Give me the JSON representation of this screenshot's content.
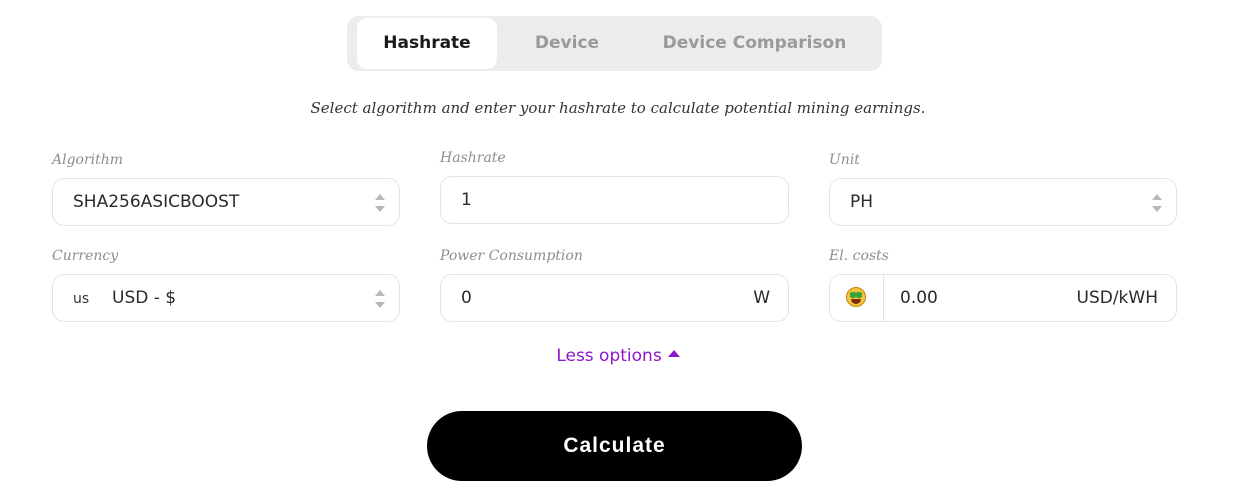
{
  "tabs": {
    "hashrate": "Hashrate",
    "device": "Device",
    "comparison": "Device Comparison",
    "active": "Hashrate"
  },
  "subtitle": "Select algorithm and enter your hashrate to calculate potential mining earnings.",
  "form": {
    "algorithm": {
      "label": "Algorithm",
      "value": "SHA256ASICBOOST"
    },
    "hashrate": {
      "label": "Hashrate",
      "value": "1"
    },
    "unit": {
      "label": "Unit",
      "value": "PH"
    },
    "currency": {
      "label": "Currency",
      "flag": "us",
      "value": "USD - $"
    },
    "power": {
      "label": "Power Consumption",
      "value": "0",
      "suffix": "W"
    },
    "el_costs": {
      "label": "El. costs",
      "icon": "money-mouth-face-icon",
      "value": "0.00",
      "suffix": "USD/kWH"
    }
  },
  "less_options": "Less options",
  "calculate": "Calculate",
  "colors": {
    "accent": "#8e17c9",
    "button_bg": "#000000",
    "tab_bg": "#ececec"
  }
}
